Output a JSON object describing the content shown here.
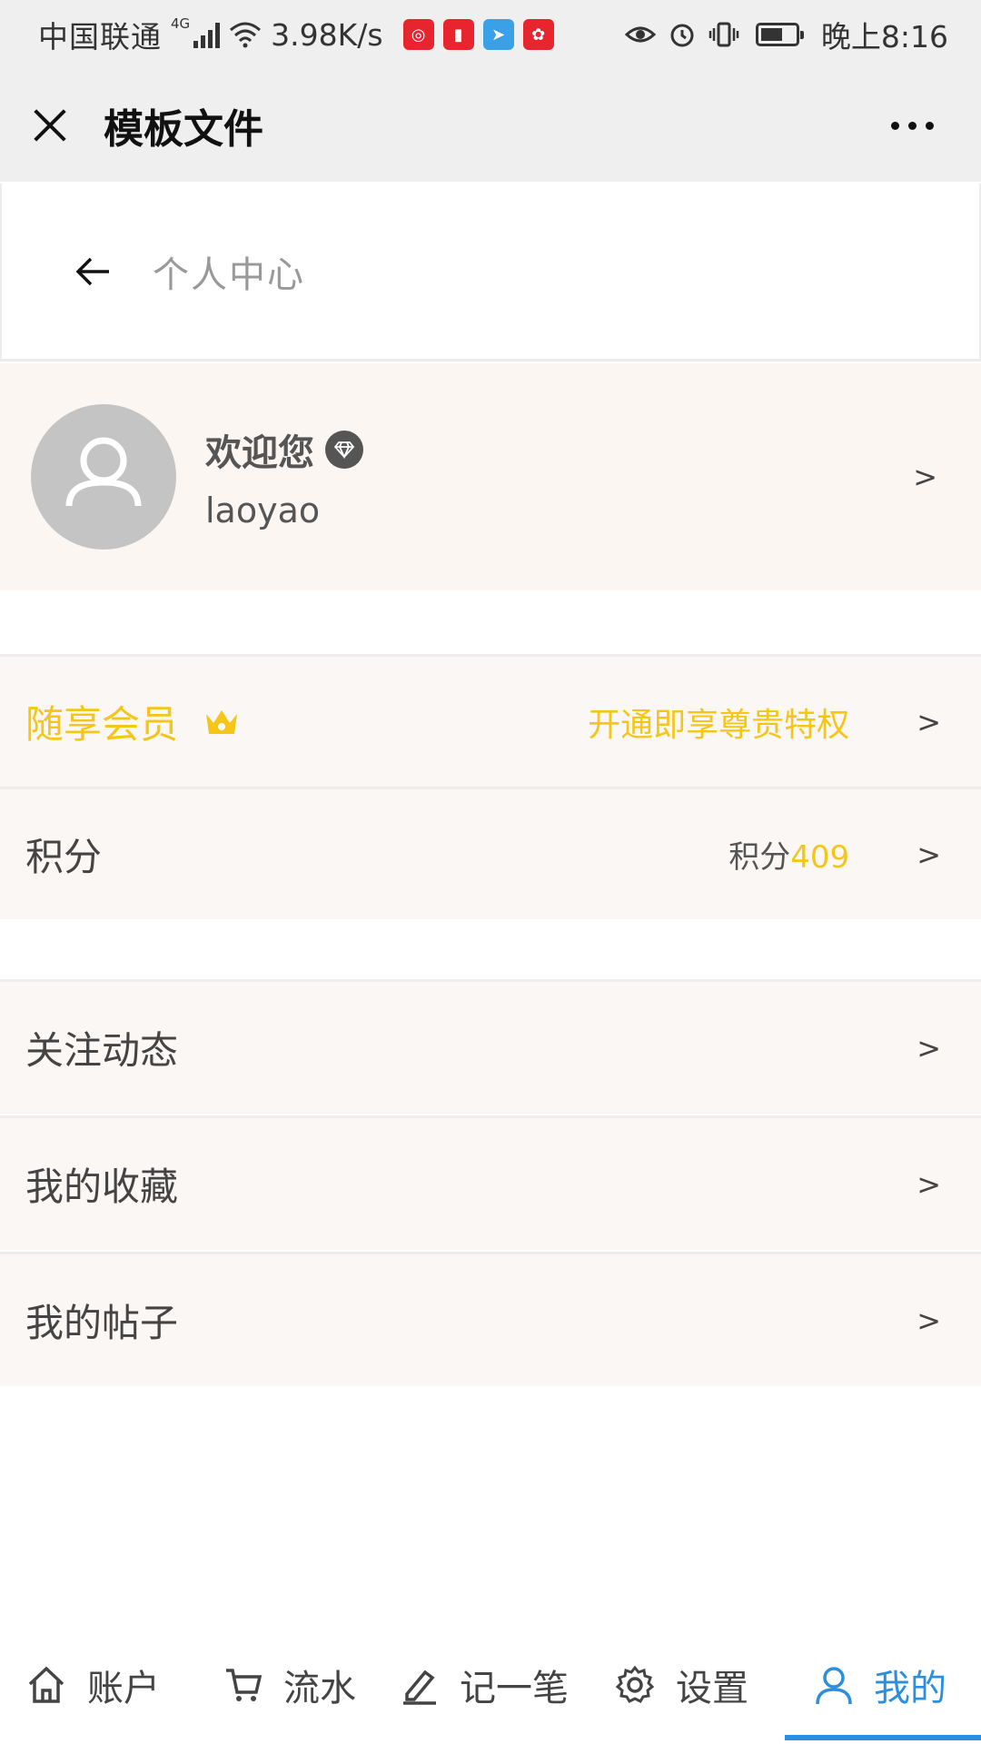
{
  "status_bar": {
    "carrier": "中国联通",
    "network_type": "4G",
    "speed": "3.98K/s",
    "time": "晚上8:16"
  },
  "title_bar": {
    "title": "模板文件"
  },
  "page_header": {
    "title": "个人中心"
  },
  "profile": {
    "welcome": "欢迎您",
    "username": "laoyao",
    "chevron": ">"
  },
  "rows": {
    "member": {
      "label": "随享会员",
      "hint": "开通即享尊贵特权",
      "chevron": ">"
    },
    "points": {
      "label": "积分",
      "prefix": "积分",
      "value": "409",
      "chevron": ">"
    },
    "follow": {
      "label": "关注动态",
      "chevron": ">"
    },
    "favorites": {
      "label": "我的收藏",
      "chevron": ">"
    },
    "posts": {
      "label": "我的帖子",
      "chevron": ">"
    }
  },
  "tabs": [
    {
      "label": "账户",
      "icon": "home-icon"
    },
    {
      "label": "流水",
      "icon": "cart-icon"
    },
    {
      "label": "记一笔",
      "icon": "pen-icon"
    },
    {
      "label": "设置",
      "icon": "gear-icon"
    },
    {
      "label": "我的",
      "icon": "user-icon",
      "active": true
    }
  ],
  "colors": {
    "accent": "#2b8fe0",
    "member_gold": "#f5c518",
    "row_background": "#fbf7f5"
  }
}
